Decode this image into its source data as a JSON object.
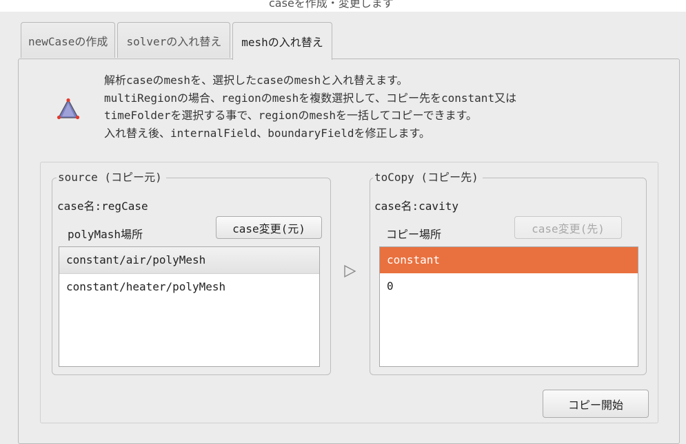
{
  "top_clipped_text": "caseを作成・変更します",
  "tabs": [
    {
      "label": "newCaseの作成",
      "active": false
    },
    {
      "label": "solverの入れ替え",
      "active": false
    },
    {
      "label": "meshの入れ替え",
      "active": true
    }
  ],
  "description": {
    "icon": "warning-triangle-icon",
    "lines": [
      "解析caseのmeshを、選択したcaseのmeshと入れ替えます。",
      "multiRegionの場合、regionのmeshを複数選択して、コピー先をconstant又は",
      "timeFolderを選択する事で、regionのmeshを一括してコピーできます。",
      "入れ替え後、internalField、boundaryFieldを修正します。"
    ]
  },
  "source": {
    "title": "source (コピー元)",
    "case_label": "case名:regCase",
    "location_label": "polyMash場所",
    "change_button": "case変更(元)",
    "items": [
      "constant/air/polyMesh",
      "constant/heater/polyMesh"
    ],
    "selected_index": 0
  },
  "arrow_icon": "play-arrow-icon",
  "destination": {
    "title": "toCopy (コピー先)",
    "case_label": "case名:cavity",
    "location_label": "コピー場所",
    "change_button": "case変更(先)",
    "change_button_disabled": true,
    "items": [
      "constant",
      "0"
    ],
    "selected_index": 0
  },
  "start_copy_button": "コピー開始",
  "colors": {
    "selection_orange": "#e9713f",
    "window_bg": "#ececec"
  }
}
